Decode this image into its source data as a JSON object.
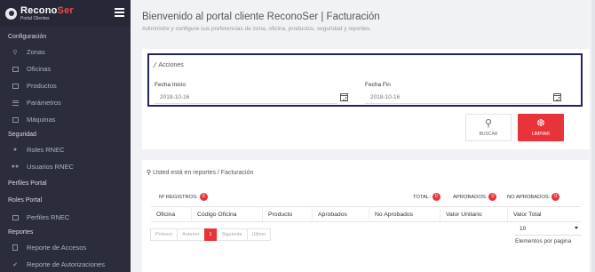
{
  "brand": {
    "name_main": "Recono",
    "name_accent": "Ser",
    "subtitle": "Portal Clientes"
  },
  "sidebar": {
    "sections": [
      {
        "title": "Configuración",
        "items": [
          {
            "label": "Zonas",
            "icon": "map-pin-icon"
          },
          {
            "label": "Oficinas",
            "icon": "building-icon"
          },
          {
            "label": "Productos",
            "icon": "card-icon"
          },
          {
            "label": "Parámetros",
            "icon": "sliders-icon"
          },
          {
            "label": "Máquinas",
            "icon": "monitor-icon"
          }
        ]
      },
      {
        "title": "Seguridad",
        "items": [
          {
            "label": "Roles RNEC",
            "icon": "user-icon"
          },
          {
            "label": "Usuarios RNEC",
            "icon": "users-icon"
          }
        ]
      },
      {
        "title": "Perfiles Portal",
        "items": []
      },
      {
        "title": "Roles Portal",
        "items": [
          {
            "label": "Perfiles RNEC",
            "icon": "card-icon"
          }
        ]
      },
      {
        "title": "Reportes",
        "items": [
          {
            "label": "Reporte de Accesos",
            "icon": "document-icon"
          },
          {
            "label": "Reporte de Autorizaciones",
            "icon": "check-icon"
          }
        ]
      }
    ]
  },
  "header": {
    "title": "Bienvenido al portal cliente ReconoSer | Facturación",
    "description": "Administre y configure sus preferencias de zona, oficina, productos, seguridad y reportes."
  },
  "actions": {
    "title": "Acciones",
    "fecha_inicio_label": "Fecha Inicio",
    "fecha_inicio_value": "2018-10-16",
    "fecha_fin_label": "Fecha Fin",
    "fecha_fin_value": "2018-10-16",
    "buscar_label": "BUSCAR",
    "limpiar_label": "LIMPIAR"
  },
  "report": {
    "location": "Usted está en reportes / Facturación",
    "registros_label": "Nº REGISTROS:",
    "registros_value": "0",
    "total_label": "TOTAL:",
    "total_value": "0",
    "aprobados_label": "APROBADOS:",
    "aprobados_value": "0",
    "no_aprobados_label": "NO APROBADOS:",
    "no_aprobados_value": "0",
    "columns": [
      "Oficina",
      "Código Oficina",
      "Producto",
      "Aprobados",
      "No Aprobados",
      "Valor Unitario",
      "Valor Total"
    ],
    "pager": {
      "first": "Primero",
      "prev": "Anterior",
      "current": "1",
      "next": "Siguiente",
      "last": "Ultimo"
    },
    "page_size_value": "10",
    "page_size_label": "Elementos por pagina"
  },
  "colors": {
    "sidebar_bg": "#2b2d3c",
    "accent_red": "#e8333b",
    "action_border": "#21265a"
  }
}
